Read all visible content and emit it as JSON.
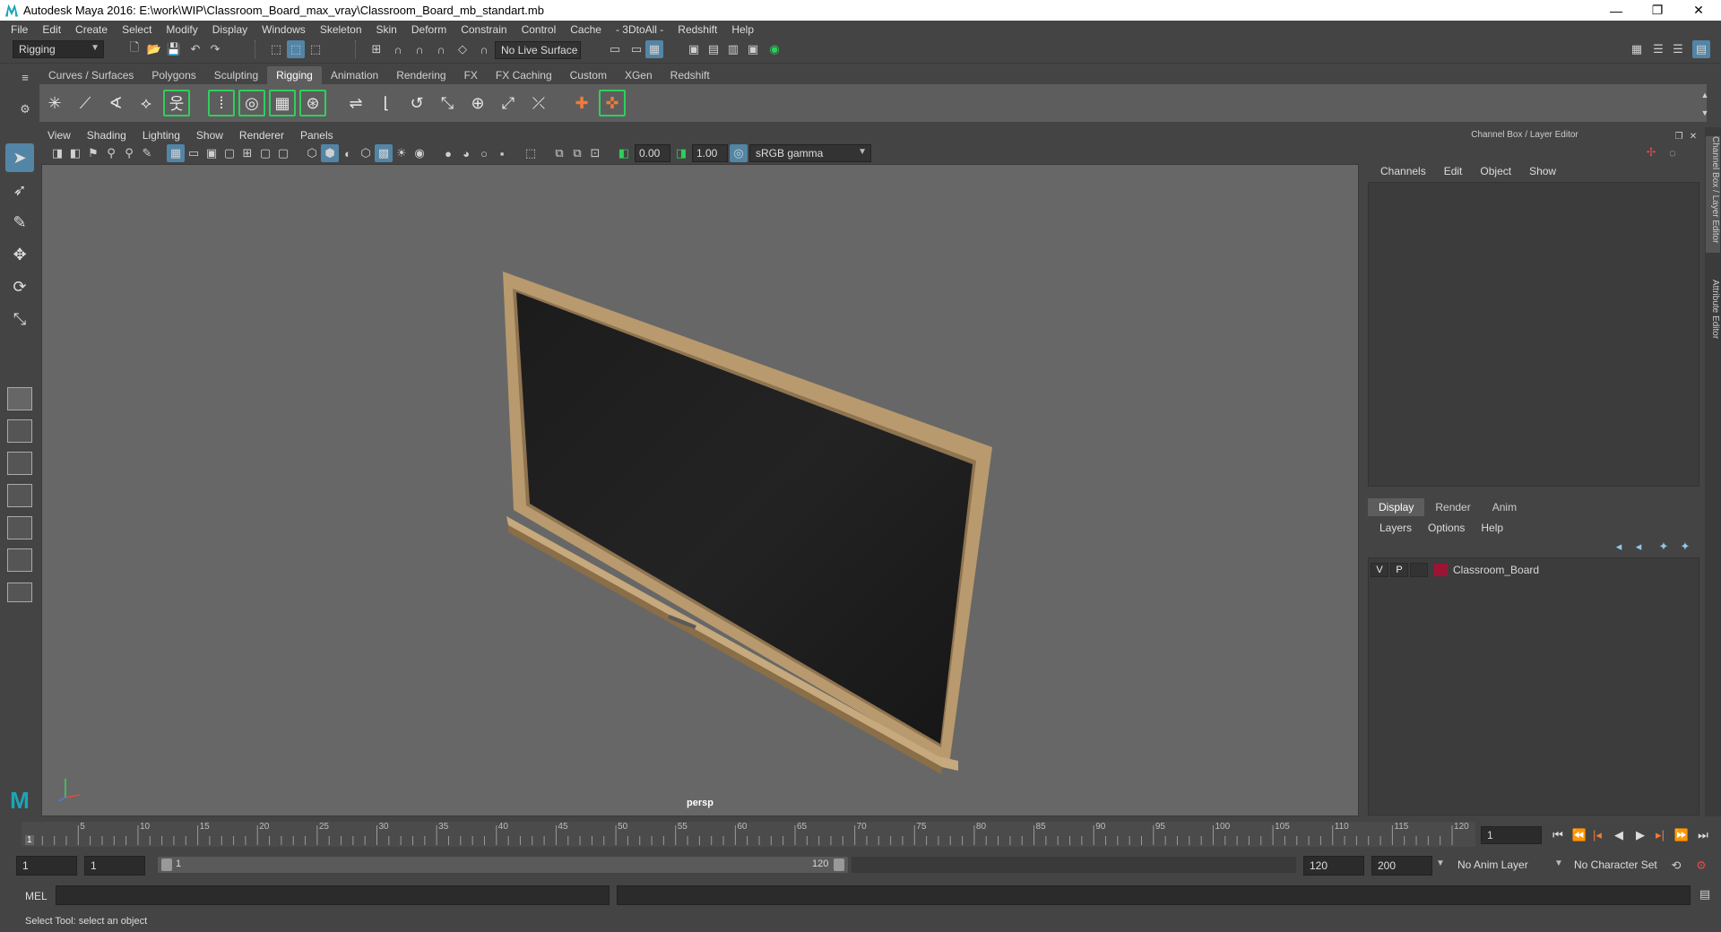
{
  "window": {
    "title": "Autodesk Maya 2016: E:\\work\\WIP\\Classroom_Board_max_vray\\Classroom_Board_mb_standart.mb",
    "minimize": "—",
    "restore": "❐",
    "close": "✕"
  },
  "menubar": [
    "File",
    "Edit",
    "Create",
    "Select",
    "Modify",
    "Display",
    "Windows",
    "Skeleton",
    "Skin",
    "Deform",
    "Constrain",
    "Control",
    "Cache",
    "- 3DtoAll -",
    "Redshift",
    "Help"
  ],
  "statusline": {
    "mode": "Rigging",
    "live_surface": "No Live Surface"
  },
  "shelf": {
    "tabs": [
      "Curves / Surfaces",
      "Polygons",
      "Sculpting",
      "Rigging",
      "Animation",
      "Rendering",
      "FX",
      "FX Caching",
      "Custom",
      "XGen",
      "Redshift"
    ],
    "active_tab": "Rigging"
  },
  "viewport": {
    "menu": [
      "View",
      "Shading",
      "Lighting",
      "Show",
      "Renderer",
      "Panels"
    ],
    "exposure": "0.00",
    "gamma": "1.00",
    "color_space": "sRGB gamma",
    "camera": "persp"
  },
  "channel_box": {
    "title": "Channel Box / Layer Editor",
    "menu": [
      "Channels",
      "Edit",
      "Object",
      "Show"
    ]
  },
  "layer_editor": {
    "tabs": [
      "Display",
      "Render",
      "Anim"
    ],
    "active_tab": "Display",
    "menu": [
      "Layers",
      "Options",
      "Help"
    ],
    "layer": {
      "visible": "V",
      "playback": "P",
      "name": "Classroom_Board",
      "color": "#9b1433"
    }
  },
  "side_tabs": [
    "Channel Box / Layer Editor",
    "Attribute Editor"
  ],
  "timeline": {
    "start_marker": "1",
    "ticks": [
      "5",
      "10",
      "15",
      "20",
      "25",
      "30",
      "35",
      "40",
      "45",
      "50",
      "55",
      "60",
      "65",
      "70",
      "75",
      "80",
      "85",
      "90",
      "95",
      "100",
      "105",
      "110",
      "115",
      "120"
    ],
    "current_frame": "1"
  },
  "range": {
    "start": "1",
    "playback_start": "1",
    "slider_start": "1",
    "slider_end": "120",
    "playback_end": "120",
    "end": "200",
    "anim_layer": "No Anim Layer",
    "character_set": "No Character Set"
  },
  "command": {
    "label": "MEL"
  },
  "help_line": "Select Tool: select an object"
}
